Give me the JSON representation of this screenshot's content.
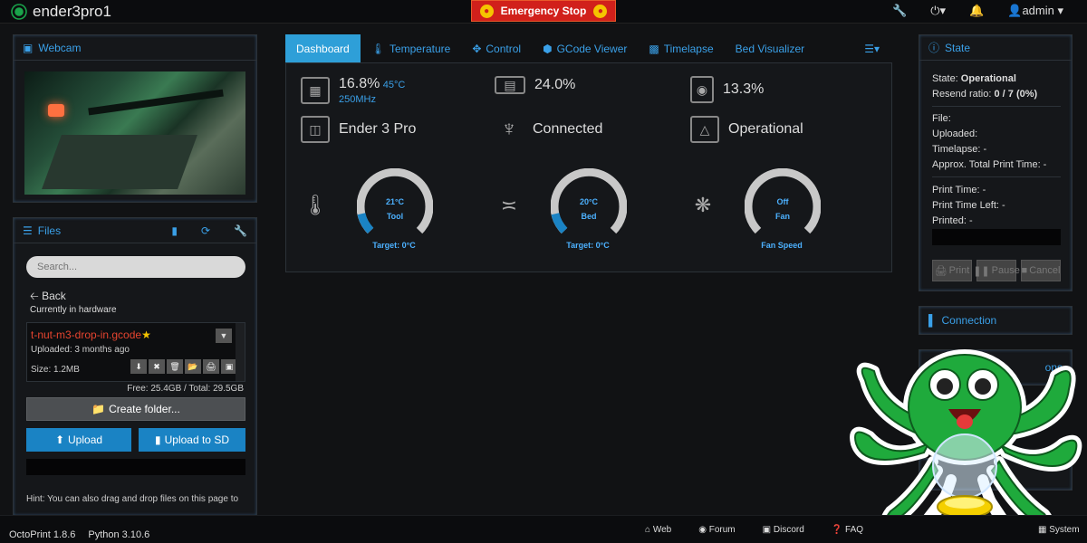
{
  "navbar": {
    "brand": "ender3pro1",
    "emergency_stop": "Emergency Stop",
    "user": "admin"
  },
  "webcam": {
    "title": "Webcam"
  },
  "files": {
    "title": "Files",
    "search_placeholder": "Search...",
    "back": "Back",
    "current_location": "Currently in hardware",
    "item": {
      "name": "t-nut-m3-drop-in.gcode",
      "uploaded": "Uploaded: 3 months ago",
      "size": "Size: 1.2MB"
    },
    "storage": "Free: 25.4GB / Total: 29.5GB",
    "create_folder": "Create folder...",
    "upload": "Upload",
    "upload_sd": "Upload to SD",
    "hint": "Hint: You can also drag and drop files on this page to"
  },
  "tabs": [
    {
      "label": "Dashboard"
    },
    {
      "label": "Temperature"
    },
    {
      "label": "Control"
    },
    {
      "label": "GCode Viewer"
    },
    {
      "label": "Timelapse"
    },
    {
      "label": "Bed Visualizer"
    }
  ],
  "dashboard": {
    "cpu": "16.8%",
    "cpu_temp": "45°C",
    "cpu_freq": "250MHz",
    "memory": "24.0%",
    "disk": "13.3%",
    "printer": "Ender 3 Pro",
    "connection": "Connected",
    "status": "Operational",
    "gauges": [
      {
        "value": "21°C",
        "label": "Tool",
        "target": "Target: 0°C",
        "fraction": 0.12
      },
      {
        "value": "20°C",
        "label": "Bed",
        "target": "Target: 0°C",
        "fraction": 0.12
      },
      {
        "value": "Off",
        "label": "Fan",
        "target": "Fan Speed",
        "fraction": 0
      }
    ]
  },
  "state": {
    "title": "State",
    "state_label": "State: ",
    "state_value": "Operational",
    "resend_label": "Resend ratio: ",
    "resend_value": "0 / 7 (0%)",
    "file": "File:",
    "uploaded": "Uploaded:",
    "timelapse": "Timelapse: -",
    "approx": "Approx. Total Print Time: -",
    "print_time": "Print Time: -",
    "time_left": "Print Time Left: -",
    "printed": "Printed: -",
    "btn_print": "Print",
    "btn_pause": "Pause",
    "btn_cancel": "Cancel"
  },
  "connection": {
    "title": "Connection"
  },
  "partial_panel": {
    "title": "ons"
  },
  "footer": {
    "octoprint": "OctoPrint 1.8.6",
    "python": "Python 3.10.6",
    "links": [
      {
        "label": "Web"
      },
      {
        "label": "Forum"
      },
      {
        "label": "Discord"
      },
      {
        "label": "FAQ"
      }
    ],
    "system": "System"
  },
  "colors": {
    "accent": "#3aa0e8",
    "tab_active": "#2e9fd8",
    "emergency": "#d1201b",
    "file_name": "#e5442f",
    "mascot_green": "#1faa3c"
  }
}
